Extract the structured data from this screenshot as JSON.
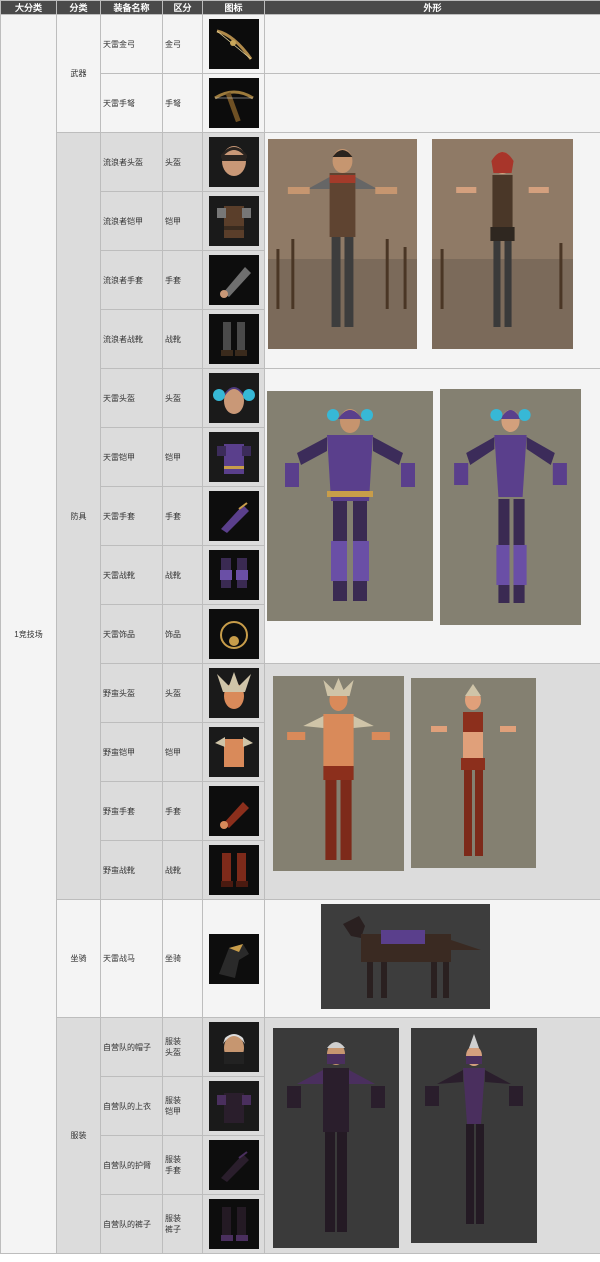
{
  "headers": {
    "category": "大分类",
    "subcategory": "分类",
    "name": "装备名称",
    "slot": "区分",
    "icon": "图标",
    "look": "外形"
  },
  "main_category": "1竞技场",
  "groups": {
    "weapon": {
      "label": "武器",
      "items": [
        {
          "name": "天雷金弓",
          "slot": "金弓",
          "icon": "bow-icon"
        },
        {
          "name": "天雷手弩",
          "slot": "手弩",
          "icon": "crossbow-icon"
        }
      ]
    },
    "armor": {
      "label": "防具",
      "items": [
        {
          "name": "流浪者头盔",
          "slot": "头盔",
          "icon": "helmet-icon"
        },
        {
          "name": "流浪者铠甲",
          "slot": "铠甲",
          "icon": "chest-armor-icon"
        },
        {
          "name": "流浪者手套",
          "slot": "手套",
          "icon": "glove-icon"
        },
        {
          "name": "流浪者战靴",
          "slot": "战靴",
          "icon": "boots-icon"
        },
        {
          "name": "天雷头盔",
          "slot": "头盔",
          "icon": "helmet-icon"
        },
        {
          "name": "天雷铠甲",
          "slot": "铠甲",
          "icon": "chest-armor-icon"
        },
        {
          "name": "天雷手套",
          "slot": "手套",
          "icon": "glove-icon"
        },
        {
          "name": "天雷战靴",
          "slot": "战靴",
          "icon": "boots-icon"
        },
        {
          "name": "天雷饰品",
          "slot": "饰品",
          "icon": "accessory-icon"
        },
        {
          "name": "野蛮头盔",
          "slot": "头盔",
          "icon": "helmet-icon"
        },
        {
          "name": "野蛮铠甲",
          "slot": "铠甲",
          "icon": "chest-armor-icon"
        },
        {
          "name": "野蛮手套",
          "slot": "手套",
          "icon": "glove-icon"
        },
        {
          "name": "野蛮战靴",
          "slot": "战靴",
          "icon": "boots-icon"
        }
      ]
    },
    "mount": {
      "label": "坐骑",
      "items": [
        {
          "name": "天雷战马",
          "slot": "坐骑",
          "icon": "warhorse-icon"
        }
      ]
    },
    "outfit": {
      "label": "服装",
      "items": [
        {
          "name": "自营队的帽子",
          "slot_line1": "服装",
          "slot_line2": "头盔",
          "icon": "hood-icon"
        },
        {
          "name": "自营队的上衣",
          "slot_line1": "服装",
          "slot_line2": "铠甲",
          "icon": "chest-armor-icon"
        },
        {
          "name": "自营队的护臂",
          "slot_line1": "服装",
          "slot_line2": "手套",
          "icon": "glove-icon"
        },
        {
          "name": "自营队的裤子",
          "slot_line1": "服装",
          "slot_line2": "裤子",
          "icon": "boots-icon"
        }
      ]
    }
  },
  "palette": {
    "header_bg": "#4a4a4a",
    "row_light": "#f4f4f4",
    "row_gray": "#dcdcdc",
    "wanderer_leather": "#6b4a32",
    "thunder_purple": "#5a3f8c",
    "savage_skin": "#d98a5a",
    "shadow_purple": "#4a2f5e"
  },
  "looks": {
    "wanderer": "wanderer-set-preview",
    "thunder": "thunder-set-preview",
    "savage": "savage-set-preview",
    "horse": "thunder-warhorse-preview",
    "shadow": "shadow-outfit-preview"
  }
}
